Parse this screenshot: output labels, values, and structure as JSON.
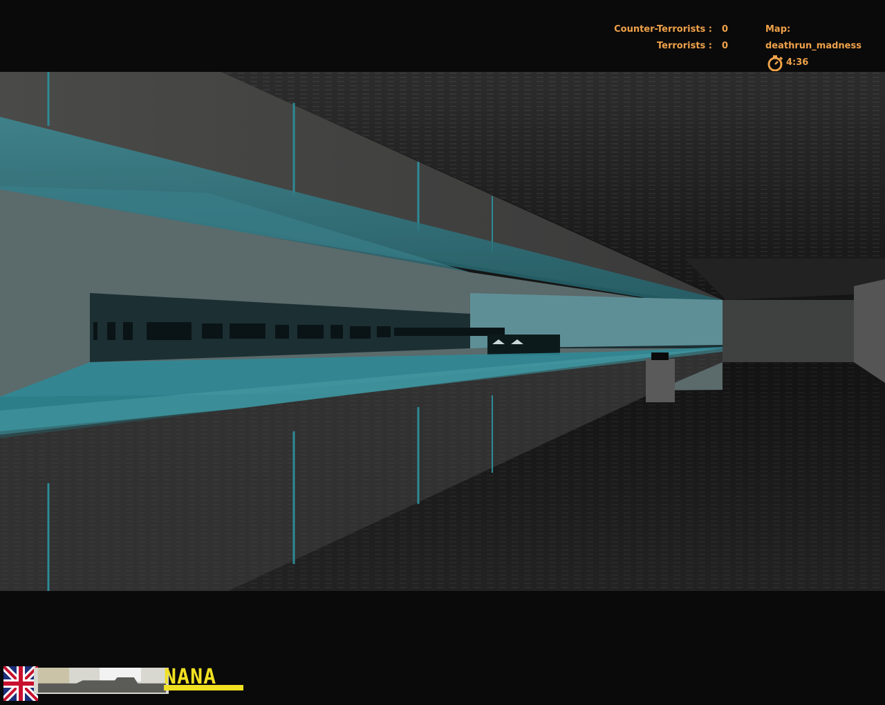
{
  "hud": {
    "ct_label": "Counter-Terrorists :",
    "ct_score": "0",
    "t_label": "Terrorists :",
    "t_score": "0",
    "map_label": "Map: deathrun_madness",
    "timer": "4:36",
    "timer_icon": "stopwatch-icon"
  },
  "player_card": {
    "flag_icon": "uk-flag-icon",
    "tag": "NANA"
  },
  "colors": {
    "hud_text": "#f0a24a",
    "tag_yellow": "#f1e021",
    "wall_cyan": "#2f8c98"
  }
}
